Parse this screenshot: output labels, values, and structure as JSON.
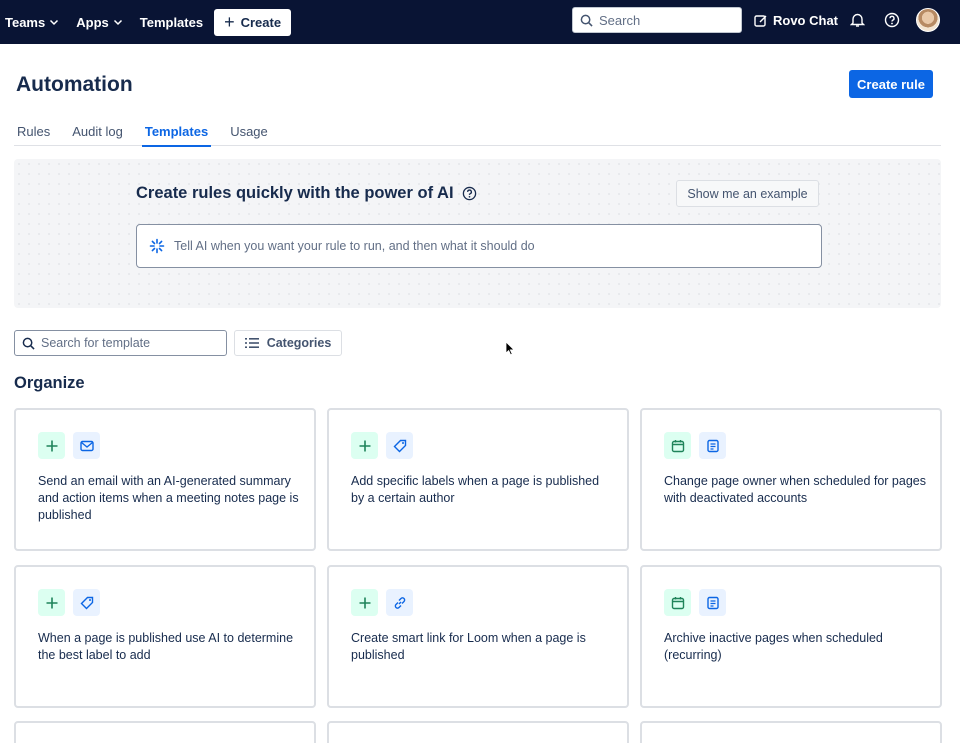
{
  "nav": {
    "teams": "Teams",
    "apps": "Apps",
    "templates": "Templates",
    "create": "Create",
    "search_placeholder": "Search",
    "rovo_chat": "Rovo Chat"
  },
  "header": {
    "title": "Automation",
    "create_rule": "Create rule"
  },
  "tabs": [
    {
      "label": "Rules"
    },
    {
      "label": "Audit log"
    },
    {
      "label": "Templates"
    },
    {
      "label": "Usage"
    }
  ],
  "active_tab": "Templates",
  "ai_panel": {
    "title": "Create rules quickly with the power of AI",
    "example_button": "Show me an example",
    "input_placeholder": "Tell AI when you want your rule to run, and then what it should do"
  },
  "templates": {
    "search_placeholder": "Search for template",
    "categories_button": "Categories",
    "section_title": "Organize",
    "cards": [
      {
        "icons": [
          "plus-icon",
          "mail-icon"
        ],
        "text": "Send an email with an AI-generated summary and action items when a meeting notes page is published"
      },
      {
        "icons": [
          "plus-icon",
          "tag-icon"
        ],
        "text": "Add specific labels when a page is published by a certain author"
      },
      {
        "icons": [
          "calendar-icon",
          "page-icon"
        ],
        "text": "Change page owner when scheduled for pages with deactivated accounts"
      },
      {
        "icons": [
          "plus-icon",
          "tag-icon"
        ],
        "text": "When a page is published use AI to determine the best label to add"
      },
      {
        "icons": [
          "plus-icon",
          "link-icon"
        ],
        "text": "Create smart link for Loom when a page is published"
      },
      {
        "icons": [
          "calendar-icon",
          "page-icon"
        ],
        "text": "Archive inactive pages when scheduled (recurring)"
      }
    ]
  },
  "colors": {
    "nav_bg": "#091434",
    "primary": "#0c66e4",
    "icon_green_bg": "#dcfff1",
    "icon_blue_bg": "#e9f2ff"
  }
}
